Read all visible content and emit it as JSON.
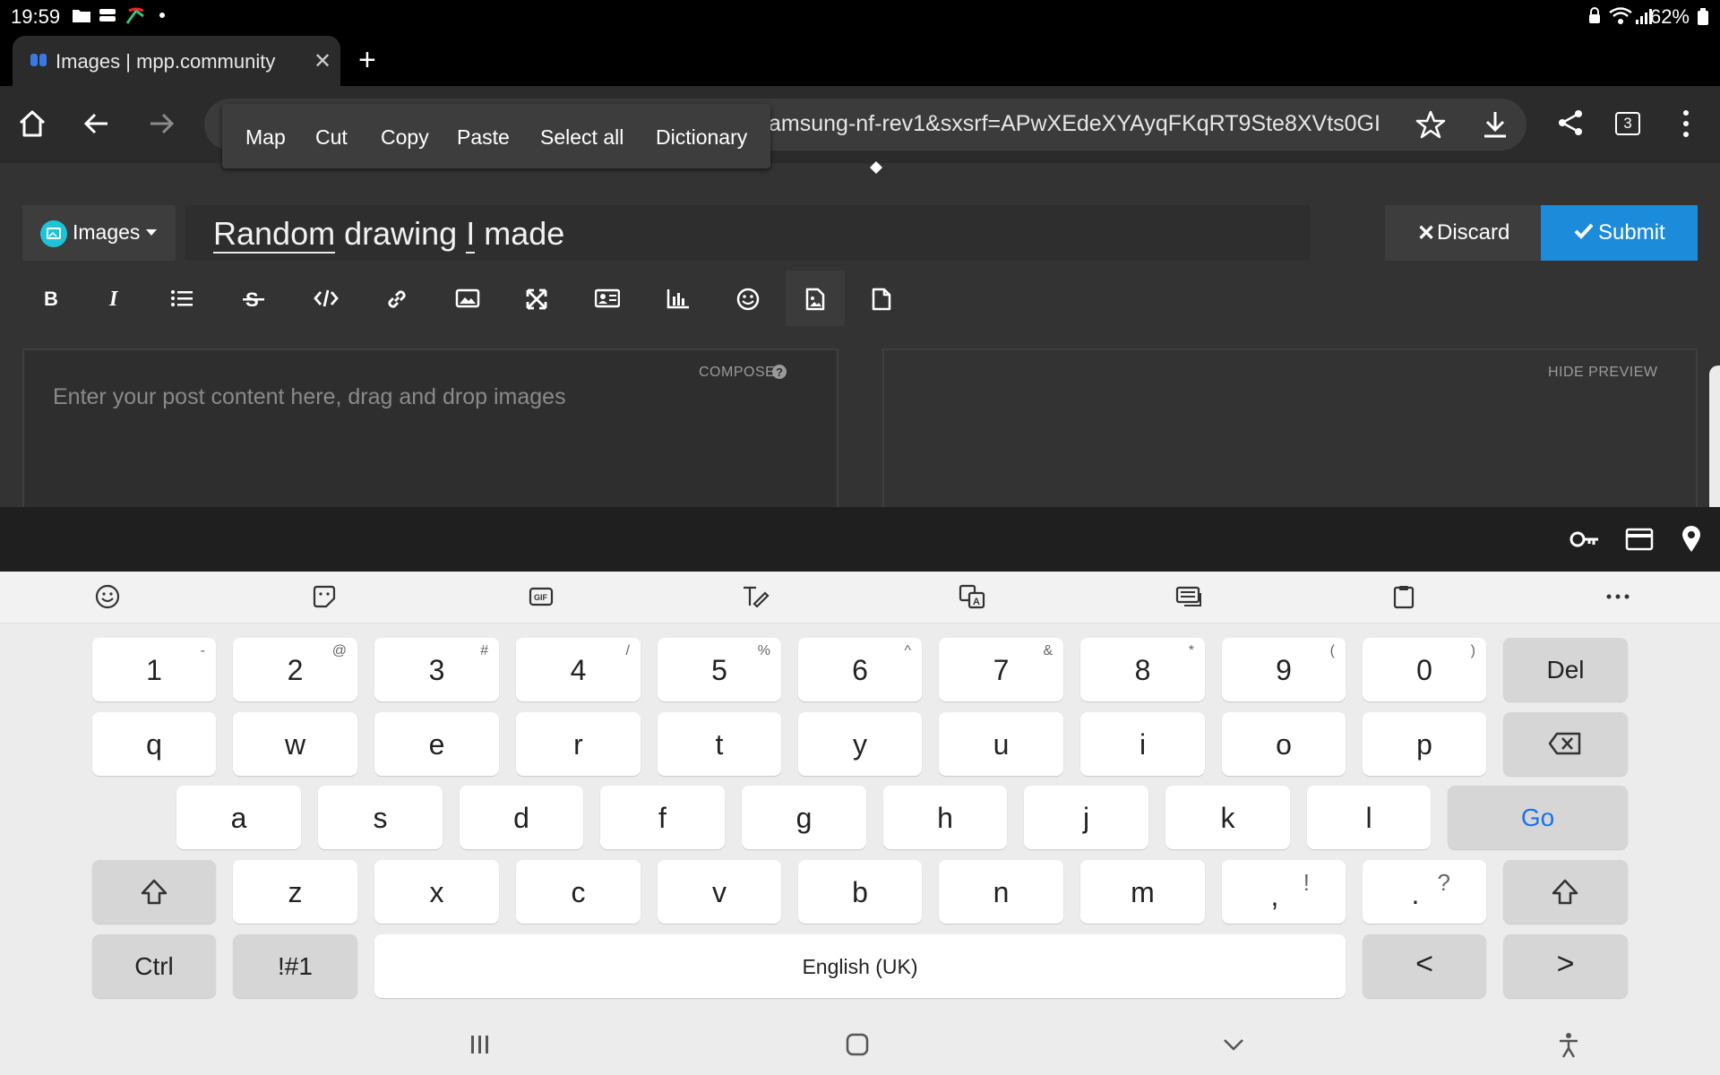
{
  "status_bar": {
    "time": "19:59",
    "battery": "62%"
  },
  "tab": {
    "title": "Images | mpp.community",
    "tab_count": "3"
  },
  "url_bar": {
    "url": "amsung-nf-rev1&sxsrf=APwXEdeXYAyqFKqRT9Ste8XVts0GI"
  },
  "context_menu": {
    "items": [
      "Map",
      "Cut",
      "Copy",
      "Paste",
      "Select all",
      "Dictionary"
    ]
  },
  "composer": {
    "category": "Images",
    "title_words": [
      "Random",
      "drawing",
      "I",
      "made"
    ],
    "discard_label": "Discard",
    "submit_label": "Submit",
    "compose_label": "COMPOSE",
    "compose_placeholder": "Enter your post content here, drag and drop images",
    "hide_preview_label": "HIDE PREVIEW"
  },
  "keyboard": {
    "row1": [
      {
        "m": "1",
        "s": "-"
      },
      {
        "m": "2",
        "s": "@"
      },
      {
        "m": "3",
        "s": "#"
      },
      {
        "m": "4",
        "s": "/"
      },
      {
        "m": "5",
        "s": "%"
      },
      {
        "m": "6",
        "s": "^"
      },
      {
        "m": "7",
        "s": "&"
      },
      {
        "m": "8",
        "s": "*"
      },
      {
        "m": "9",
        "s": "("
      },
      {
        "m": "0",
        "s": ")"
      }
    ],
    "row2": [
      "q",
      "w",
      "e",
      "r",
      "t",
      "y",
      "u",
      "i",
      "o",
      "p"
    ],
    "row3": [
      "a",
      "s",
      "d",
      "f",
      "g",
      "h",
      "j",
      "k",
      "l"
    ],
    "row4": [
      "z",
      "x",
      "c",
      "v",
      "b",
      "n",
      "m"
    ],
    "comma": {
      "m": ",",
      "s": "!"
    },
    "period": {
      "m": ".",
      "s": "?"
    },
    "del_label": "Del",
    "go_label": "Go",
    "ctrl_label": "Ctrl",
    "symbols_label": "!#1",
    "space_label": "English (UK)",
    "left_arrow": "<",
    "right_arrow": ">"
  },
  "colors": {
    "accent": "#1c8bd9",
    "go_text": "#1a73e8",
    "category_dot": "#1ec3d8"
  }
}
